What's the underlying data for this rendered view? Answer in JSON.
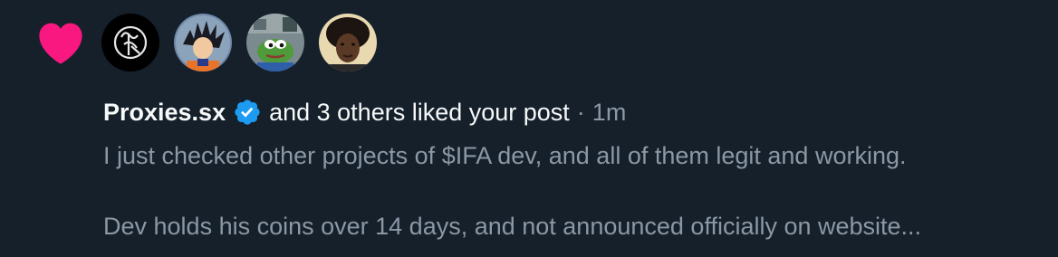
{
  "notification": {
    "type": "like",
    "heart_color": "#f91880",
    "avatars": [
      {
        "name": "Proxies.sx",
        "icon": "logo-avatar"
      },
      {
        "name": "anime-character-avatar",
        "icon": "anime-avatar"
      },
      {
        "name": "pepe-frog-avatar",
        "icon": "frog-avatar"
      },
      {
        "name": "photo-avatar",
        "icon": "person-avatar"
      }
    ],
    "user_name": "Proxies.sx",
    "verified": true,
    "verified_color": "#1d9bf0",
    "action_text": "and 3 others liked your post",
    "separator": "·",
    "time": "1m",
    "post_line_1": "I just checked other projects of $IFA dev, and all of them legit and working.",
    "post_line_2": "Dev holds his coins over 14 days, and not announced officially on website..."
  }
}
